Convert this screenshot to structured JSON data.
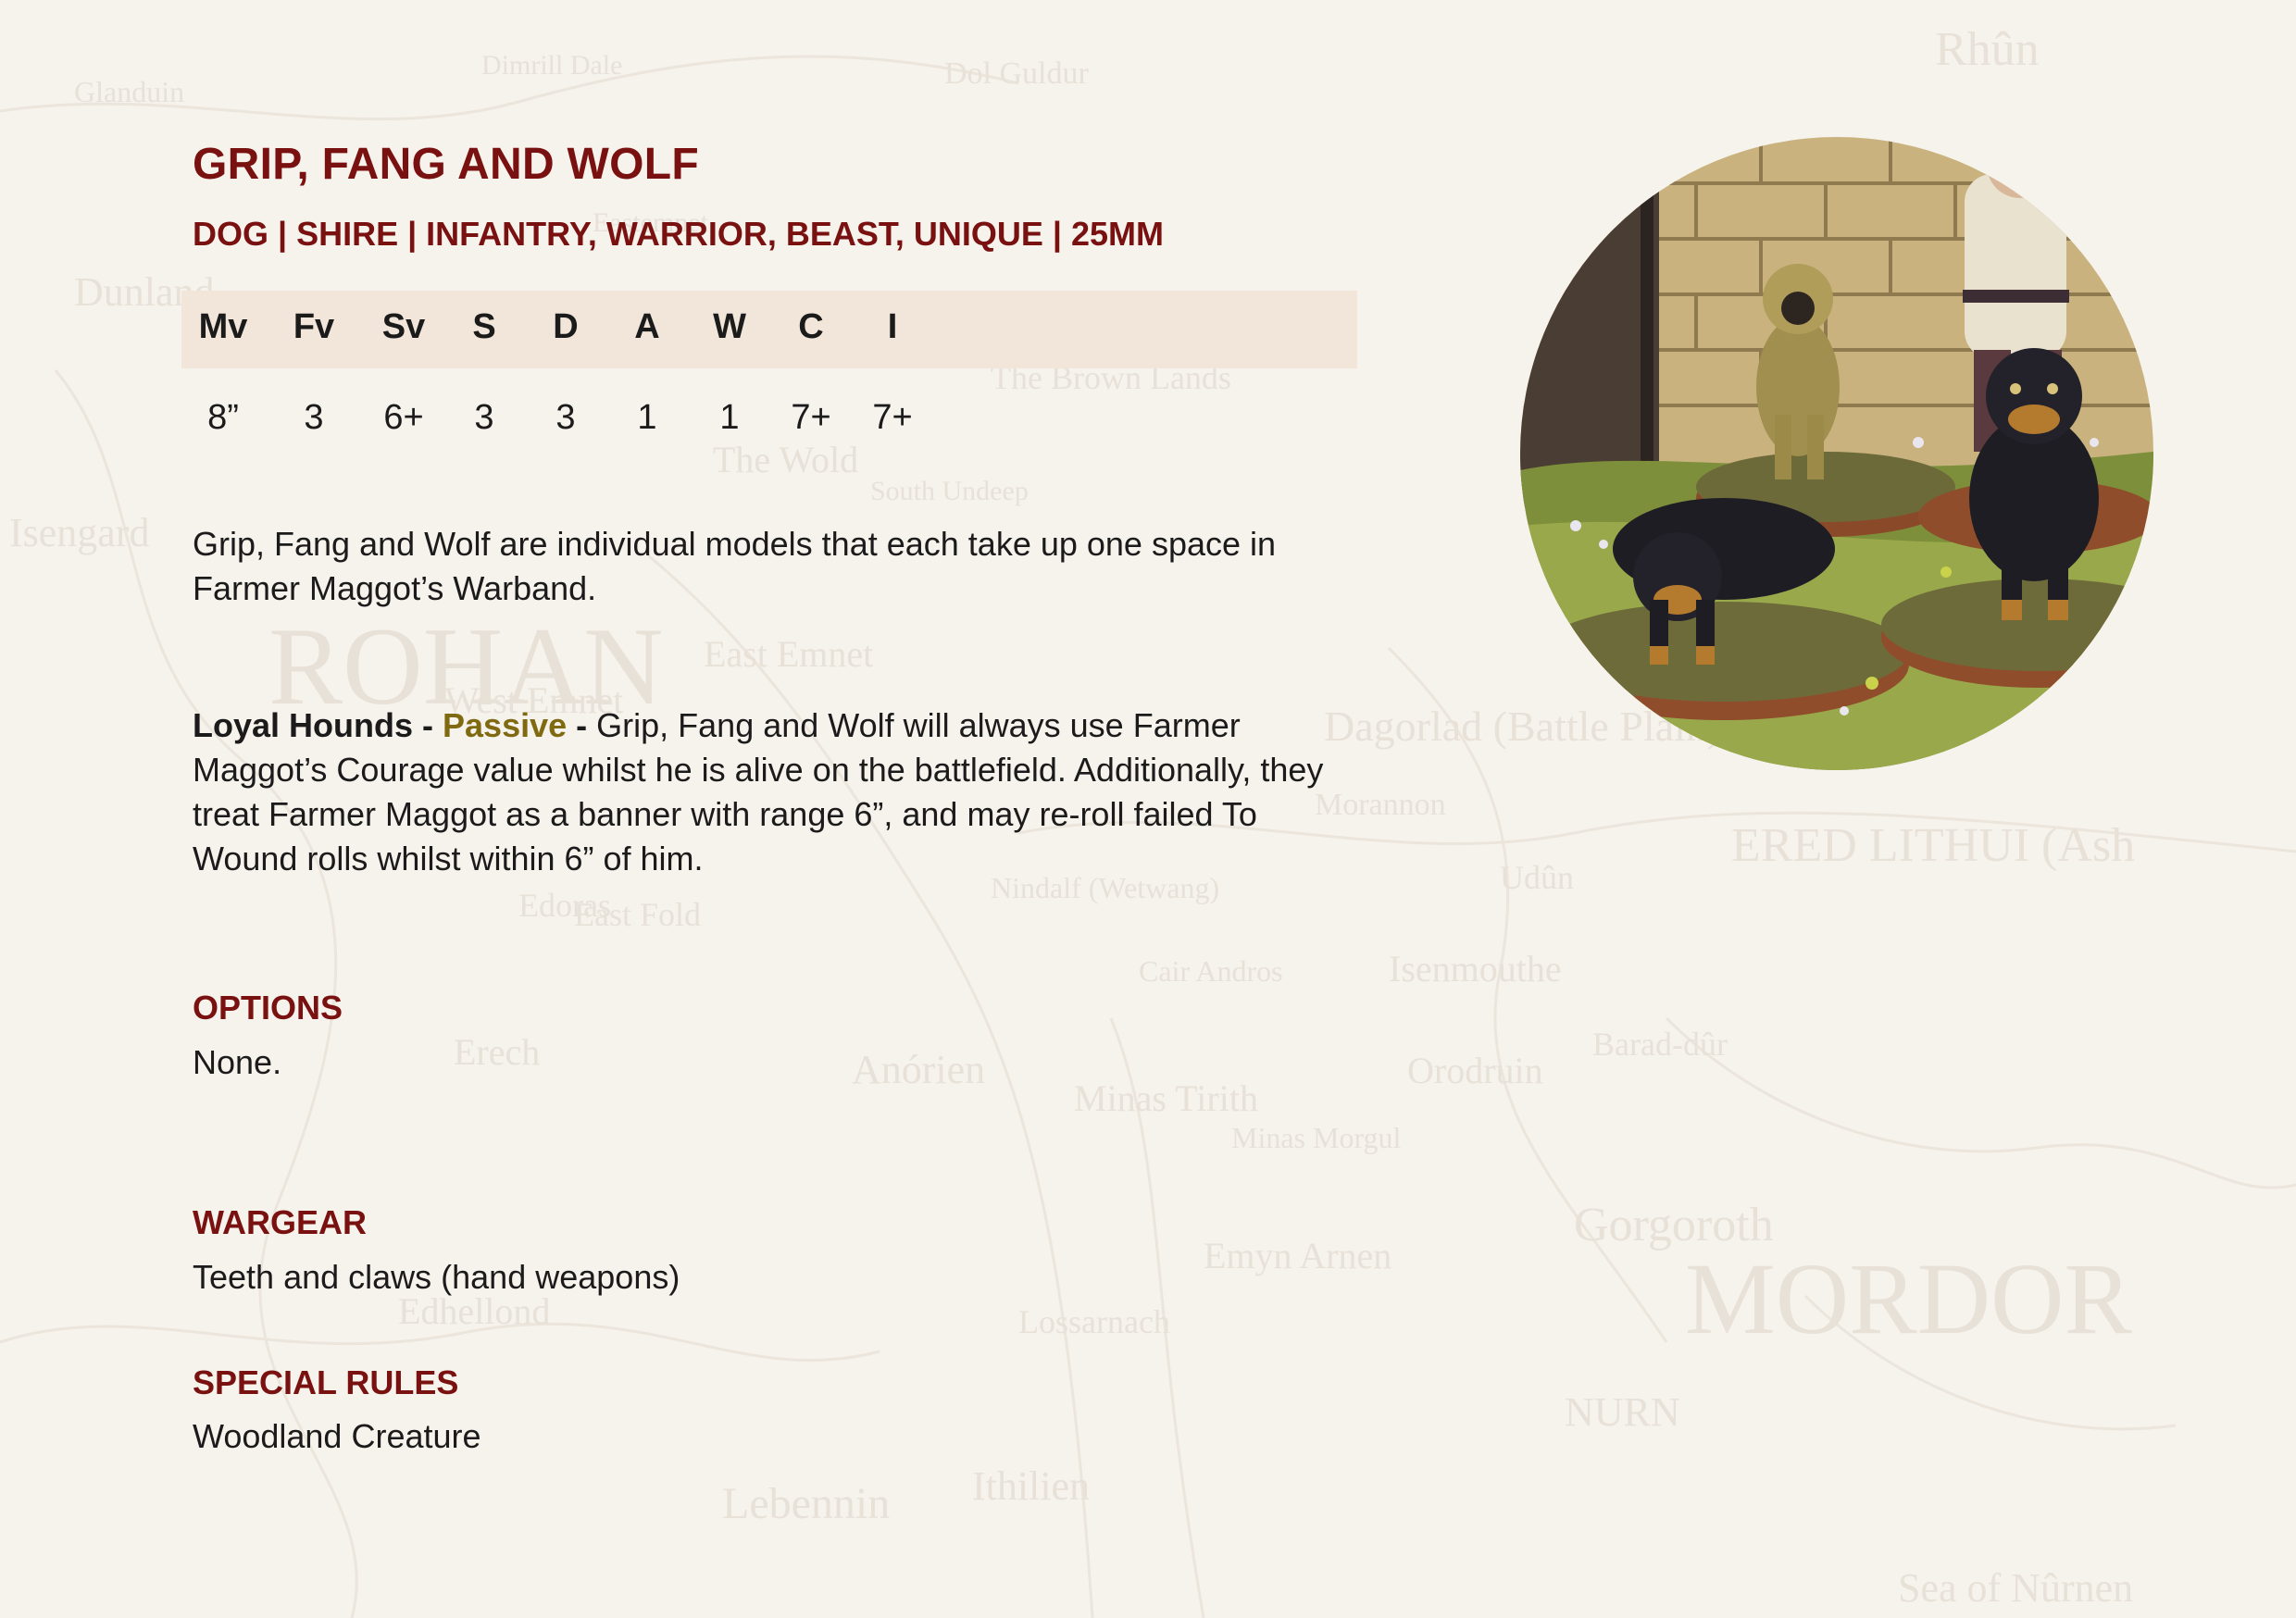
{
  "profile": {
    "title": "GRIP, FANG AND WOLF",
    "keywords": "DOG | SHIRE | INFANTRY, WARRIOR, BEAST, UNIQUE | 25MM"
  },
  "stats": {
    "headers": [
      "Mv",
      "Fv",
      "Sv",
      "S",
      "D",
      "A",
      "W",
      "C",
      "I"
    ],
    "values": [
      "8”",
      "3",
      "6+",
      "3",
      "3",
      "1",
      "1",
      "7+",
      "7+"
    ]
  },
  "intro": "Grip, Fang and Wolf are individual models that each take up one space in Farmer Maggot’s Warband.",
  "rule": {
    "name": "Loyal Hounds",
    "sep1": " - ",
    "type": "Passive",
    "sep2": " - ",
    "text": "Grip, Fang and Wolf will always use Farmer Maggot’s Courage value whilst he is alive on the battlefield. Additionally, they treat Farmer Maggot as a banner with range 6”, and may re-roll failed To Wound rolls whilst within 6” of him."
  },
  "sections": {
    "options": {
      "heading": "OPTIONS",
      "body": "None."
    },
    "wargear": {
      "heading": "WARGEAR",
      "body": "Teeth and claws (hand weapons)"
    },
    "special_rules": {
      "heading": "SPECIAL RULES",
      "body": "Woodland Creature"
    }
  },
  "background_map_labels": [
    "Rhûn",
    "ROHAN",
    "MORDOR",
    "ERED LITHUI (Ash",
    "Gorgoroth",
    "Dagorlad (Battle Plain)",
    "Isengard",
    "Dunland",
    "East Emnet",
    "West Emnet",
    "The Wold",
    "Anórien",
    "Minas Tirith",
    "Nindalf (Wetwang)",
    "Cair Andros",
    "Minas Morgul",
    "Barad-dûr",
    "Orodruin",
    "Udûn",
    "Isenmouthe",
    "NURN",
    "Sea of Nûrnen",
    "Erech",
    "Edhellond",
    "Lebennin",
    "Ithilien",
    "Emyn Arnen",
    "Lossarnach",
    "Morannon",
    "Dol Guldur",
    "The Brown Lands",
    "Edoras",
    "East Fold",
    "Glanduin",
    "Dimrill Dale",
    "Eastemnet",
    "South Undeep"
  ],
  "image": {
    "subject": "miniature-dogs-photo"
  },
  "colors": {
    "heading": "#7a1111",
    "passive": "#7f6a12",
    "stat_bar": "#f1e6d9",
    "page": "#f6f2ec"
  }
}
